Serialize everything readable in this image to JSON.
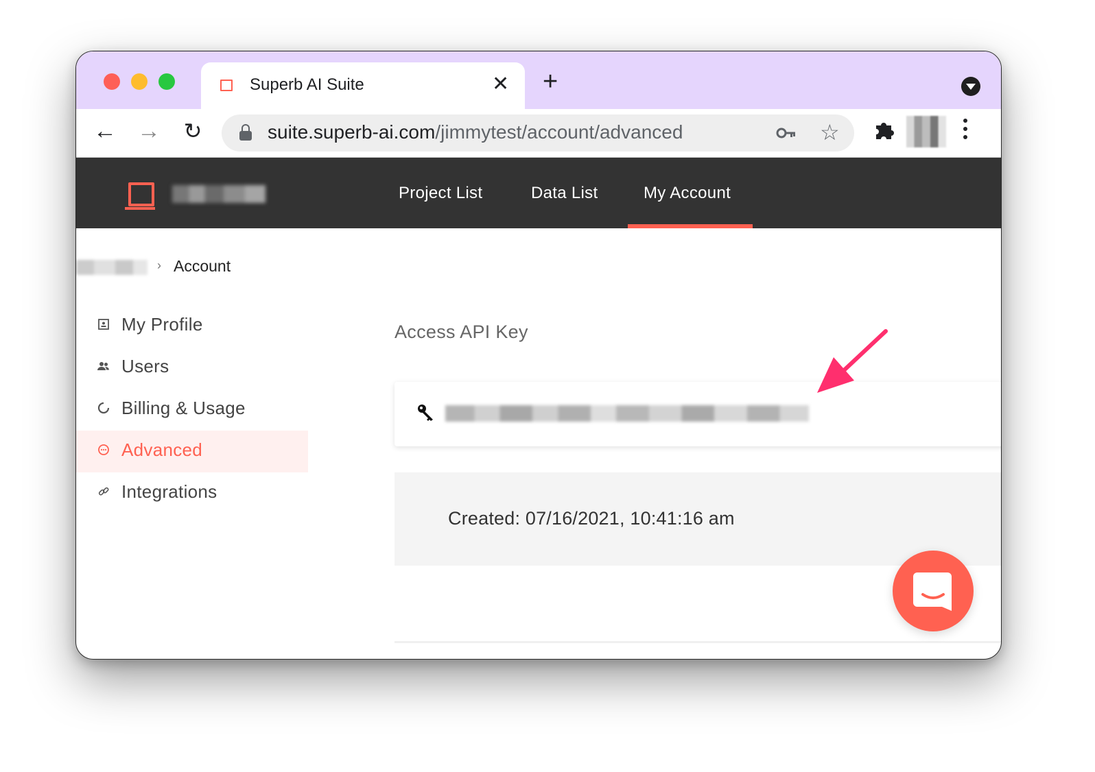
{
  "browser": {
    "tab_title": "Superb AI Suite",
    "tab_close": "✕",
    "new_tab": "+",
    "url_host": "suite.superb-ai.com",
    "url_path": "/jimmytest/account/advanced",
    "nav": {
      "back": "←",
      "forward": "→",
      "reload": "↻"
    },
    "star": "☆"
  },
  "app": {
    "nav": [
      "Project List",
      "Data List",
      "My Account"
    ],
    "active_nav": "My Account",
    "accent_color": "#ff6151"
  },
  "breadcrumb": {
    "separator": "›",
    "current": "Account"
  },
  "sidebar": {
    "items": [
      {
        "label": "My Profile",
        "icon": "profile-icon"
      },
      {
        "label": "Users",
        "icon": "users-icon"
      },
      {
        "label": "Billing & Usage",
        "icon": "billing-icon"
      },
      {
        "label": "Advanced",
        "icon": "advanced-icon",
        "active": true
      },
      {
        "label": "Integrations",
        "icon": "link-icon"
      }
    ]
  },
  "main": {
    "section_title": "Access API Key",
    "created": "Created: 07/16/2021, 10:41:16 am"
  }
}
